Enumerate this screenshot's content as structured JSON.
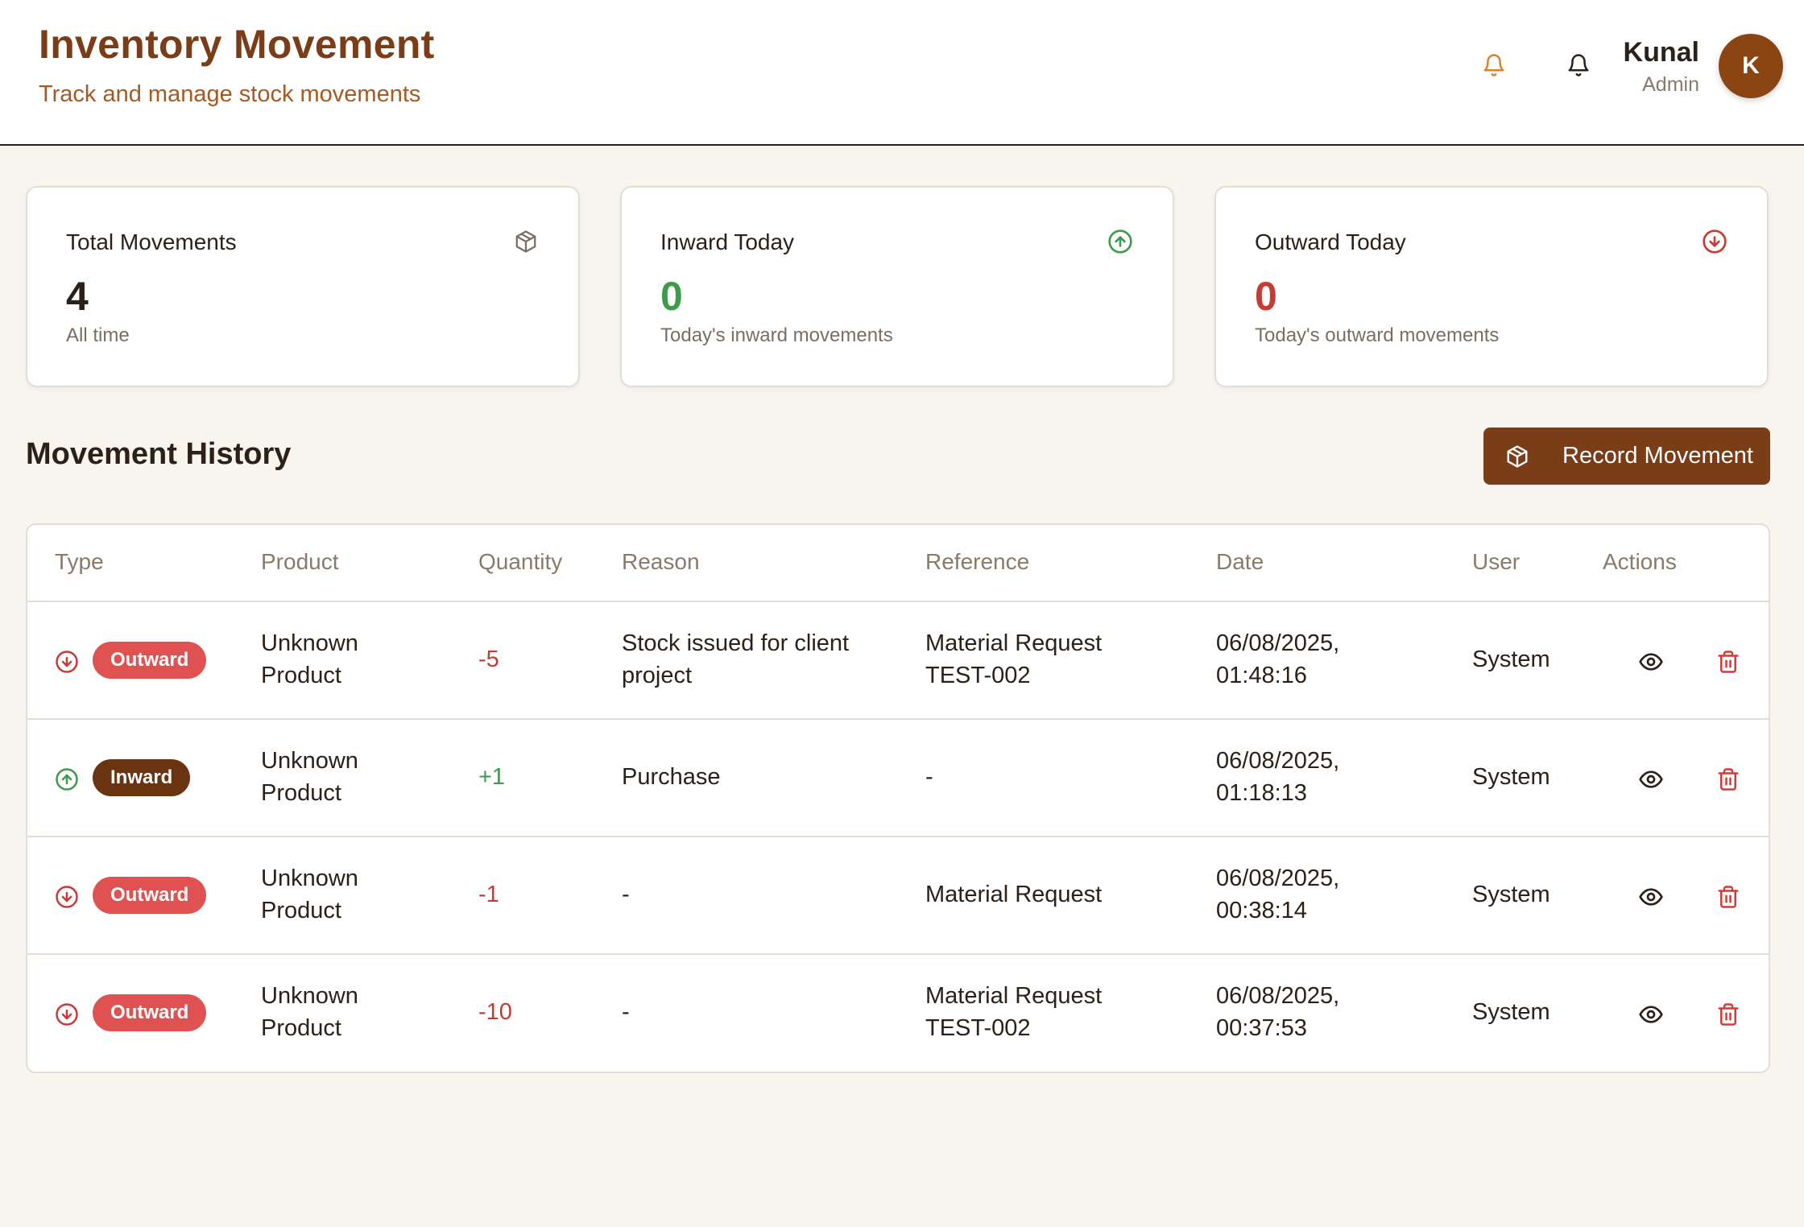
{
  "header": {
    "title": "Inventory Movement",
    "subtitle": "Track and manage stock movements",
    "user": {
      "name": "Kunal",
      "role": "Admin",
      "initial": "K"
    }
  },
  "cards": [
    {
      "title": "Total Movements",
      "value": "4",
      "subtitle": "All time",
      "icon": "package-icon",
      "color": "#2b2118"
    },
    {
      "title": "Inward Today",
      "value": "0",
      "subtitle": "Today's inward movements",
      "icon": "arrow-up-circle-icon",
      "color": "#3f9a4a"
    },
    {
      "title": "Outward Today",
      "value": "0",
      "subtitle": "Today's outward movements",
      "icon": "arrow-down-circle-icon",
      "color": "#c63b36"
    }
  ],
  "section": {
    "title": "Movement History",
    "record_button": "Record Movement"
  },
  "table": {
    "columns": [
      "Type",
      "Product",
      "Quantity",
      "Reason",
      "Reference",
      "Date",
      "User",
      "Actions"
    ],
    "rows": [
      {
        "type": "Outward",
        "product": [
          "Unknown",
          "Product"
        ],
        "quantity": "-5",
        "reason": [
          "Stock issued for client",
          "project"
        ],
        "reference": [
          "Material Request",
          "TEST-002"
        ],
        "date": [
          "06/08/2025,",
          "01:48:16"
        ],
        "user": "System"
      },
      {
        "type": "Inward",
        "product": [
          "Unknown",
          "Product"
        ],
        "quantity": "+1",
        "reason": [
          "Purchase"
        ],
        "reference": [
          "-"
        ],
        "date": [
          "06/08/2025,",
          "01:18:13"
        ],
        "user": "System"
      },
      {
        "type": "Outward",
        "product": [
          "Unknown",
          "Product"
        ],
        "quantity": "-1",
        "reason": [
          "-"
        ],
        "reference": [
          "Material Request"
        ],
        "date": [
          "06/08/2025,",
          "00:38:14"
        ],
        "user": "System"
      },
      {
        "type": "Outward",
        "product": [
          "Unknown",
          "Product"
        ],
        "quantity": "-10",
        "reason": [
          "-"
        ],
        "reference": [
          "Material Request",
          "TEST-002"
        ],
        "date": [
          "06/08/2025,",
          "00:37:53"
        ],
        "user": "System"
      }
    ]
  },
  "colors": {
    "brand": "#7a3d17",
    "inward": "#3f9a4a",
    "outward": "#c63b36",
    "badge_out": "#e05252",
    "badge_in": "#6b3410"
  }
}
